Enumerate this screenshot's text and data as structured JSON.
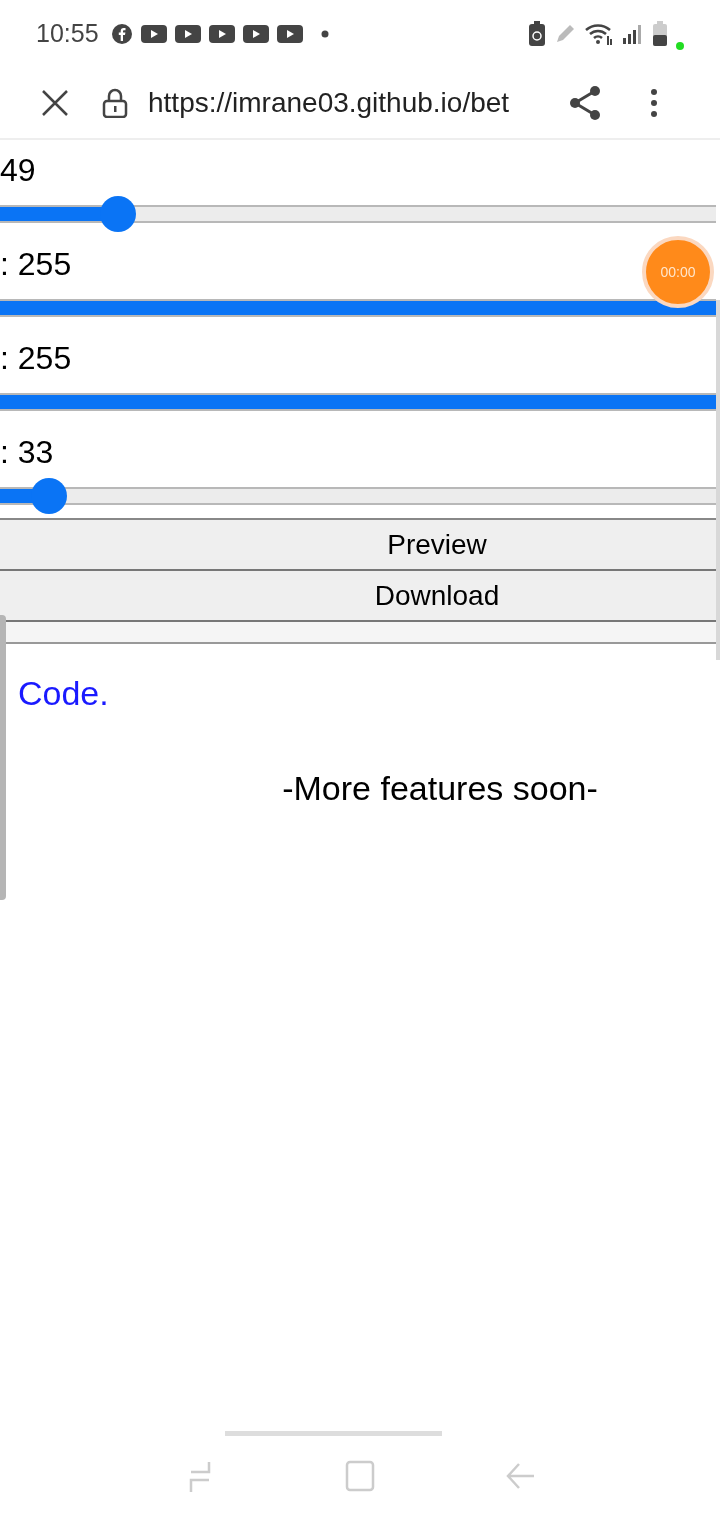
{
  "status_bar": {
    "time": "10:55"
  },
  "browser": {
    "url": "https://imrane03.github.io/bet"
  },
  "sliders": [
    {
      "label": "49",
      "level": 0.16
    },
    {
      "label": ": 255",
      "level": 1
    },
    {
      "label": ": 255",
      "level": 1
    },
    {
      "label": ": 33",
      "level": 0.07
    }
  ],
  "buttons": [
    "Preview",
    "Download"
  ],
  "link": "Code.",
  "note": "-More features soon-",
  "recorder": {
    "time": "00:00"
  }
}
